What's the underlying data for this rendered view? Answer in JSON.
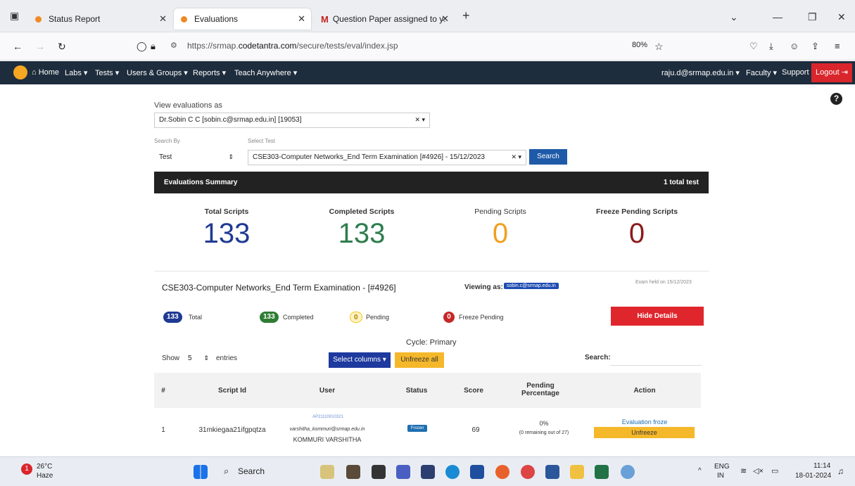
{
  "browser": {
    "tabs": [
      {
        "label": "Status Report"
      },
      {
        "label": "Evaluations"
      },
      {
        "label": "Question Paper assigned to y:"
      }
    ],
    "url_prefix": "https://srmap.",
    "url_domain": "codetantra.com",
    "url_path": "/secure/tests/eval/index.jsp",
    "zoom": "80%"
  },
  "nav": {
    "home": "Home",
    "labs": "Labs",
    "tests": "Tests",
    "users": "Users & Groups",
    "reports": "Reports",
    "teach": "Teach Anywhere",
    "user": "raju.d@srmap.edu.in",
    "faculty": "Faculty",
    "support": "Support",
    "logout": "Logout"
  },
  "form": {
    "view_as_label": "View evaluations as",
    "view_as_value": "Dr.Sobin C C [sobin.c@srmap.edu.in] [19053]",
    "search_by_label": "Search By",
    "search_by_value": "Test",
    "select_test_label": "Select Test",
    "select_test_value": "CSE303-Computer Networks_End Term Examination [#4926] - 15/12/2023",
    "search_button": "Search"
  },
  "summary": {
    "title": "Evaluations Summary",
    "count": "1 total test",
    "stats": [
      {
        "label": "Total Scripts",
        "value": "133",
        "color": "#1f3a93"
      },
      {
        "label": "Completed Scripts",
        "value": "133",
        "color": "#2e7d4f"
      },
      {
        "label": "Pending Scripts",
        "value": "0",
        "color": "#f0a020"
      },
      {
        "label": "Freeze Pending Scripts",
        "value": "0",
        "color": "#8b1c1c"
      }
    ]
  },
  "card": {
    "title": "CSE303-Computer Networks_End Term Examination - [#4926]",
    "viewing_label": "Viewing as:",
    "viewing_value": "sobin.c@srmap.edu.in",
    "exam_date": "Exam held on 15/12/2023",
    "badges": [
      {
        "count": "133",
        "label": "Total",
        "color": "#1f3a93"
      },
      {
        "count": "133",
        "label": "Completed",
        "color": "#2e7d32"
      },
      {
        "count": "0",
        "label": "Pending",
        "color": "#f5c518"
      },
      {
        "count": "0",
        "label": "Freeze Pending",
        "color": "#c62828"
      }
    ],
    "hide_details": "Hide Details",
    "cycle": "Cycle: Primary",
    "show_label": "Show",
    "show_value": "5",
    "entries_label": "entries",
    "select_columns": "Select columns",
    "unfreeze_all": "Unfreeze all",
    "search_label": "Search:"
  },
  "table": {
    "headers": [
      "#",
      "Script Id",
      "User",
      "Status",
      "Score",
      "Pending Percentage",
      "Action"
    ],
    "rows": [
      {
        "num": "1",
        "script_id": "31mkiegaa21ifgpqtza",
        "user_id": "AP21110010321",
        "user_email": "varshitha_kommuri@srmap.edu.in",
        "user_name": "KOMMURI VARSHITHA",
        "status": "Frozen",
        "score": "69",
        "pending_pct": "0%",
        "pending_note": "(0 remaining out of 27)",
        "action_status": "Evaluation froze",
        "action_button": "Unfreeze"
      }
    ]
  },
  "taskbar": {
    "temp": "26°C",
    "weather": "Haze",
    "search": "Search",
    "lang1": "ENG",
    "lang2": "IN",
    "time": "11:14",
    "date": "18-01-2024"
  }
}
